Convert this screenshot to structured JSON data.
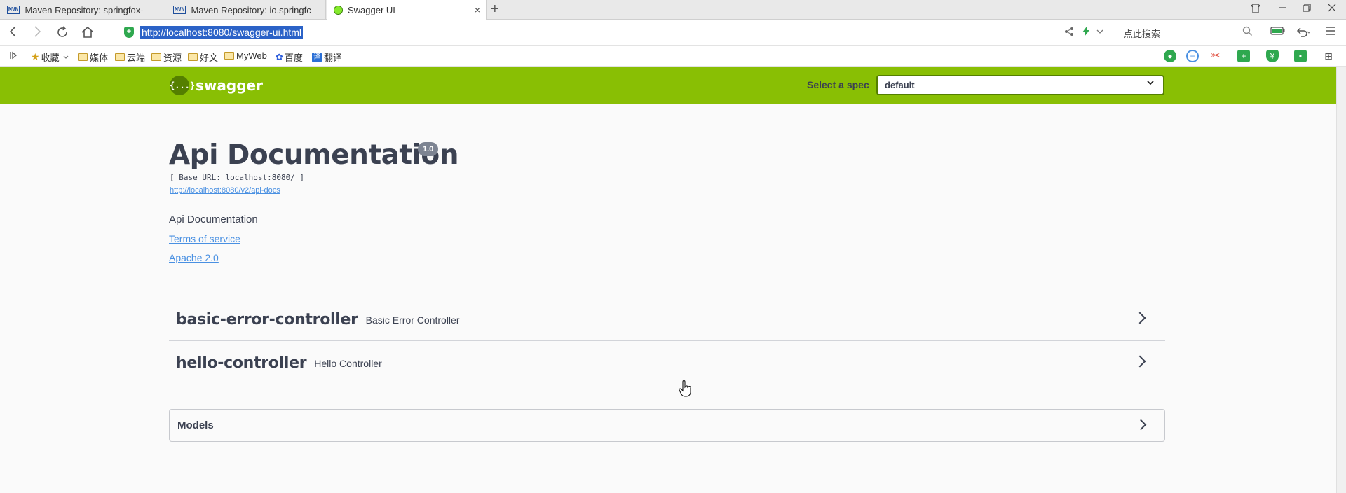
{
  "browser": {
    "tabs": [
      {
        "title": "Maven Repository: springfox-",
        "favicon": "mvn-icon",
        "active": false
      },
      {
        "title": "Maven Repository: io.springfc",
        "favicon": "mvn-icon",
        "active": false
      },
      {
        "title": "Swagger UI",
        "favicon": "swagger-icon",
        "active": true
      }
    ],
    "favicon_mvn_text": "MVN",
    "tab_close": "×",
    "new_tab": "+",
    "url": "http://localhost:8080/swagger-ui.html",
    "search_placeholder": "点此搜索",
    "bookmarks": [
      {
        "label": "收藏",
        "type": "star"
      },
      {
        "label": "媒体",
        "type": "folder"
      },
      {
        "label": "云端",
        "type": "folder"
      },
      {
        "label": "资源",
        "type": "folder"
      },
      {
        "label": "好文",
        "type": "folder"
      },
      {
        "label": "MyWeb",
        "type": "folder"
      },
      {
        "label": "百度",
        "type": "baidu"
      },
      {
        "label": "翻译",
        "type": "translate"
      }
    ]
  },
  "swagger": {
    "logo_text": "swagger",
    "logo_icon": "{...}",
    "select_spec_label": "Select a spec",
    "select_spec_value": "default",
    "info": {
      "title": "Api Documentation",
      "version": "1.0",
      "base_url": "[ Base URL: localhost:8080/ ]",
      "docs_url": "http://localhost:8080/v2/api-docs",
      "description": "Api Documentation",
      "terms": "Terms of service",
      "license": "Apache 2.0"
    },
    "tags": [
      {
        "name": "basic-error-controller",
        "description": "Basic Error Controller"
      },
      {
        "name": "hello-controller",
        "description": "Hello Controller"
      }
    ],
    "models_title": "Models"
  },
  "colors": {
    "topbar": "#89bf04",
    "link": "#4990e2",
    "text": "#3b4151",
    "url_highlight": "#2b62c7"
  }
}
